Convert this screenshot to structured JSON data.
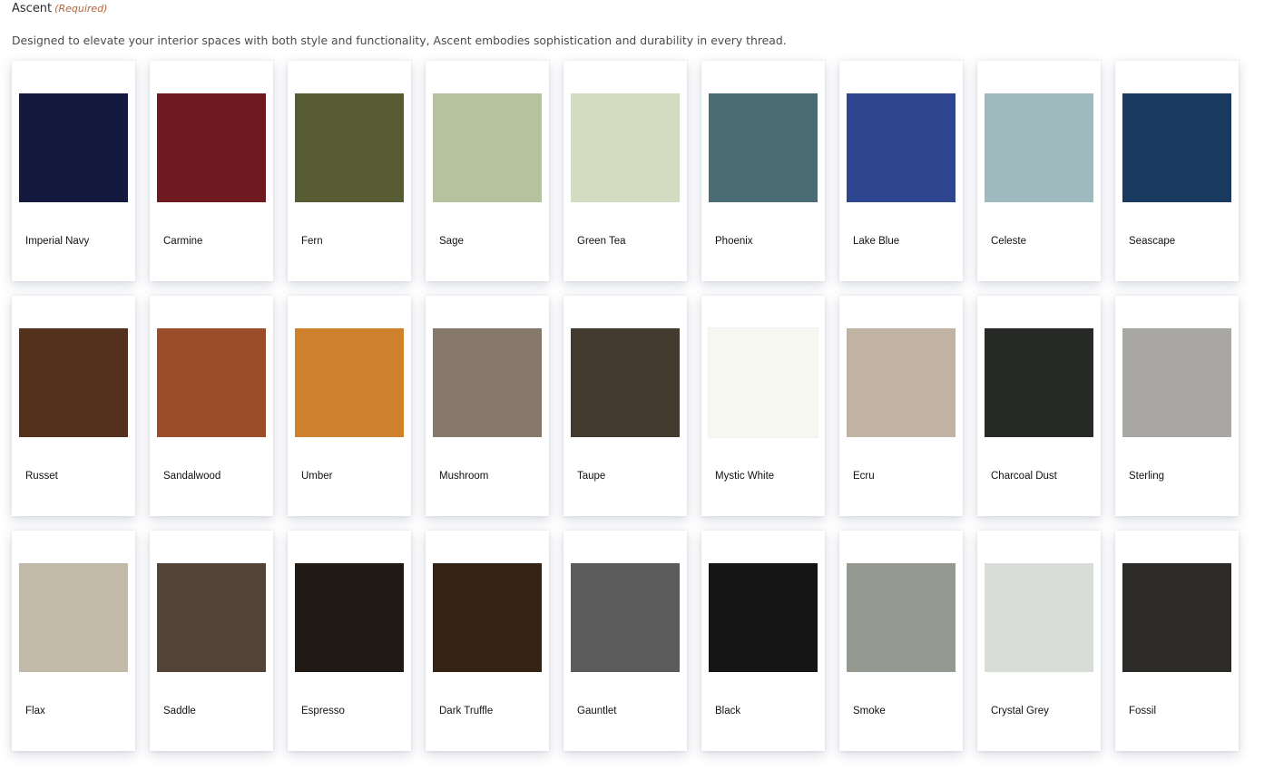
{
  "section": {
    "title": "Ascent",
    "required_label": "(Required)",
    "description": "Designed to elevate your interior spaces with both style and functionality, Ascent embodies sophistication and durability in every thread."
  },
  "colors": {
    "required_text": "#b5643a"
  },
  "swatches": [
    {
      "name": "Imperial Navy",
      "color": "#131a3e"
    },
    {
      "name": "Carmine",
      "color": "#6e1a20"
    },
    {
      "name": "Fern",
      "color": "#575c34"
    },
    {
      "name": "Sage",
      "color": "#b6c29f"
    },
    {
      "name": "Green Tea",
      "color": "#d3dcc0"
    },
    {
      "name": "Phoenix",
      "color": "#4a6d73"
    },
    {
      "name": "Lake Blue",
      "color": "#2e4690"
    },
    {
      "name": "Celeste",
      "color": "#9fbabe"
    },
    {
      "name": "Seascape",
      "color": "#1b3a5f"
    },
    {
      "name": "Russet",
      "color": "#54311c"
    },
    {
      "name": "Sandalwood",
      "color": "#9b4c29"
    },
    {
      "name": "Umber",
      "color": "#cd812d"
    },
    {
      "name": "Mushroom",
      "color": "#86796b"
    },
    {
      "name": "Taupe",
      "color": "#433a30"
    },
    {
      "name": "Mystic White",
      "color": "#f7f7f2"
    },
    {
      "name": "Ecru",
      "color": "#c0b3a4"
    },
    {
      "name": "Charcoal Dust",
      "color": "#282a27"
    },
    {
      "name": "Sterling",
      "color": "#a9a7a4"
    },
    {
      "name": "Flax",
      "color": "#c3b9a9"
    },
    {
      "name": "Saddle",
      "color": "#524437"
    },
    {
      "name": "Espresso",
      "color": "#211914"
    },
    {
      "name": "Dark Truffle",
      "color": "#342215"
    },
    {
      "name": "Gauntlet",
      "color": "#5c5c5c"
    },
    {
      "name": "Black",
      "color": "#141514"
    },
    {
      "name": "Smoke",
      "color": "#959a91"
    },
    {
      "name": "Crystal Grey",
      "color": "#d9ddd7"
    },
    {
      "name": "Fossil",
      "color": "#2d2b27"
    }
  ]
}
